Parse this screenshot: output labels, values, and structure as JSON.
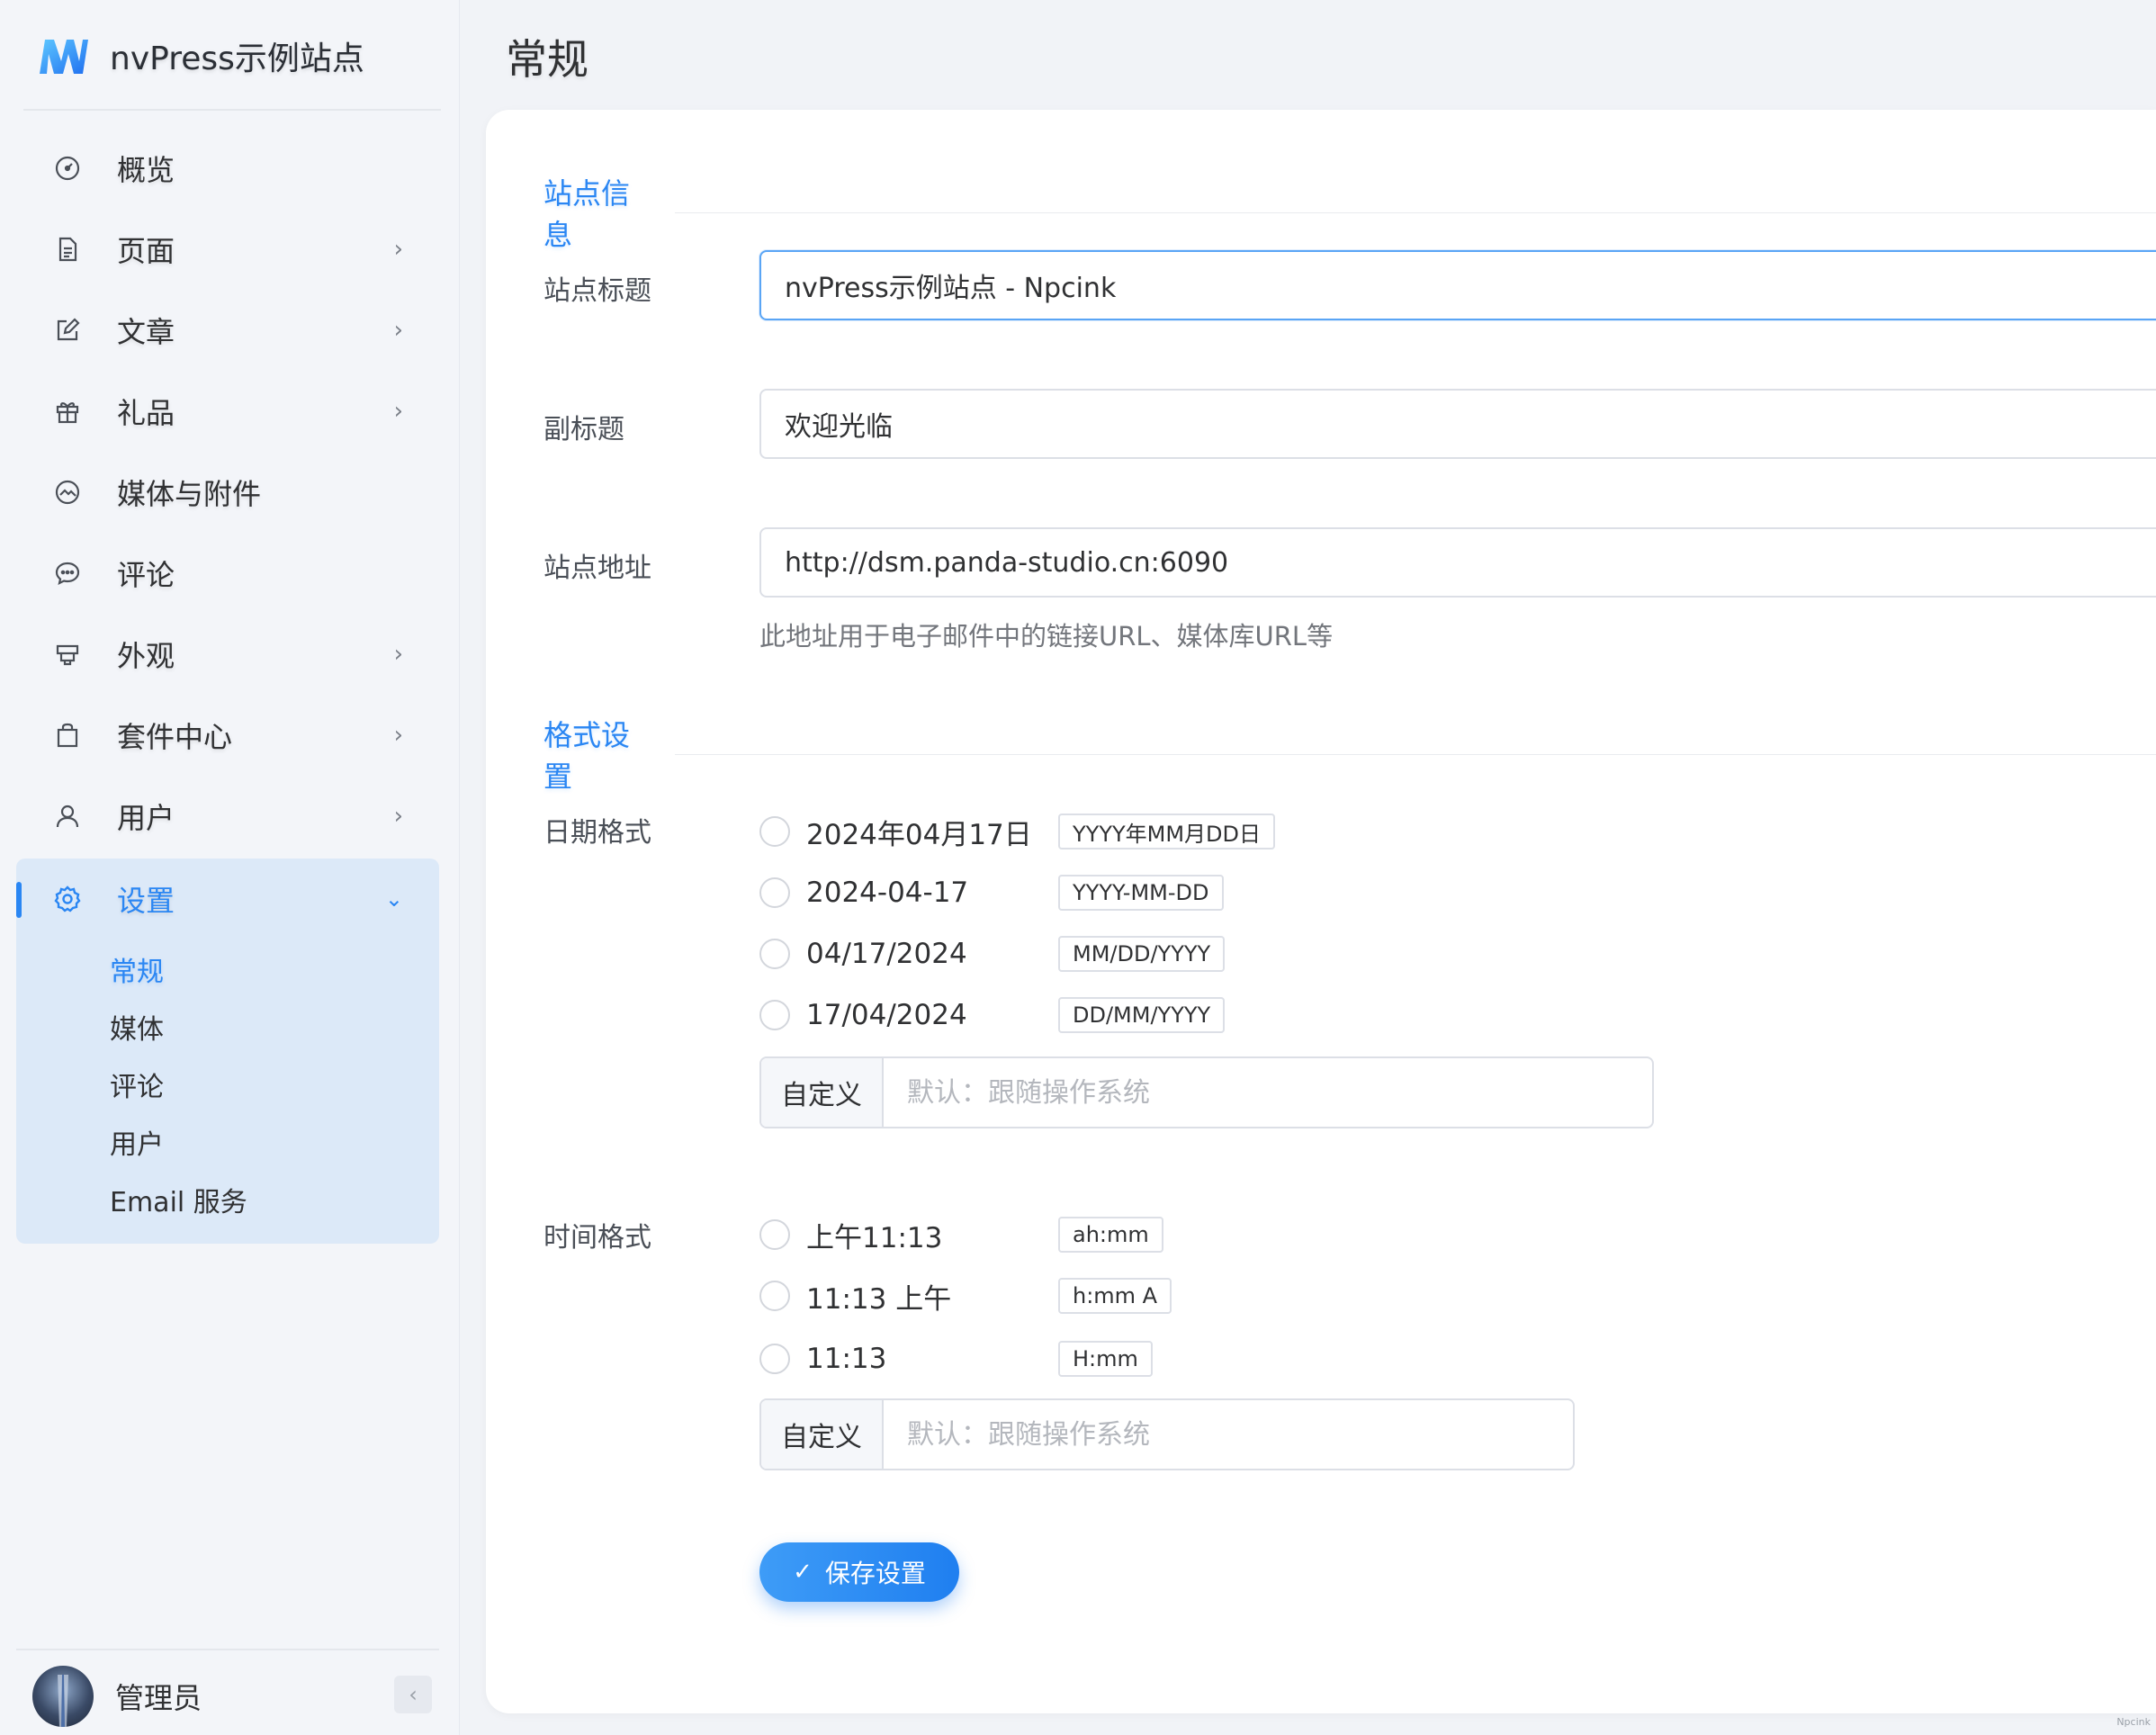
{
  "brand": {
    "name": "nvPress示例站点"
  },
  "sidebar": {
    "items": [
      {
        "label": "概览",
        "icon": "dashboard-icon",
        "has_children": false
      },
      {
        "label": "页面",
        "icon": "page-icon",
        "has_children": true
      },
      {
        "label": "文章",
        "icon": "edit-icon",
        "has_children": true
      },
      {
        "label": "礼品",
        "icon": "gift-icon",
        "has_children": true
      },
      {
        "label": "媒体与附件",
        "icon": "media-icon",
        "has_children": false
      },
      {
        "label": "评论",
        "icon": "comment-icon",
        "has_children": false
      },
      {
        "label": "外观",
        "icon": "appearance-icon",
        "has_children": true
      },
      {
        "label": "套件中心",
        "icon": "bag-icon",
        "has_children": true
      },
      {
        "label": "用户",
        "icon": "user-icon",
        "has_children": true
      }
    ],
    "settings": {
      "label": "设置",
      "icon": "gear-icon",
      "children": [
        "常规",
        "媒体",
        "评论",
        "用户",
        "Email 服务"
      ],
      "active": "常规"
    }
  },
  "user": {
    "name": "管理员"
  },
  "page": {
    "title": "常规"
  },
  "site_info": {
    "section_title": "站点信息",
    "title_label": "站点标题",
    "title_value": "nvPress示例站点 - Npcink",
    "subtitle_label": "副标题",
    "subtitle_value": "欢迎光临",
    "url_label": "站点地址",
    "url_value": "http://dsm.panda-studio.cn:6090",
    "url_hint": "此地址用于电子邮件中的链接URL、媒体库URL等"
  },
  "format": {
    "section_title": "格式设置",
    "date_label": "日期格式",
    "date_options": [
      {
        "value": "2024年04月17日",
        "tag": "YYYY年MM月DD日"
      },
      {
        "value": "2024-04-17",
        "tag": "YYYY-MM-DD"
      },
      {
        "value": "04/17/2024",
        "tag": "MM/DD/YYYY"
      },
      {
        "value": "17/04/2024",
        "tag": "DD/MM/YYYY"
      }
    ],
    "custom_label": "自定义",
    "custom_placeholder": "默认：跟随操作系统",
    "time_label": "时间格式",
    "time_options": [
      {
        "value": "上午11:13",
        "tag": "ah:mm"
      },
      {
        "value": "11:13 上午",
        "tag": "h:mm A"
      },
      {
        "value": "11:13",
        "tag": "H:mm"
      }
    ]
  },
  "save_button": "保存设置",
  "watermark": "Npcink",
  "colors": {
    "accent": "#2a86f3",
    "active_bg": "#dce9f8",
    "page_bg": "#f1f3f7"
  }
}
